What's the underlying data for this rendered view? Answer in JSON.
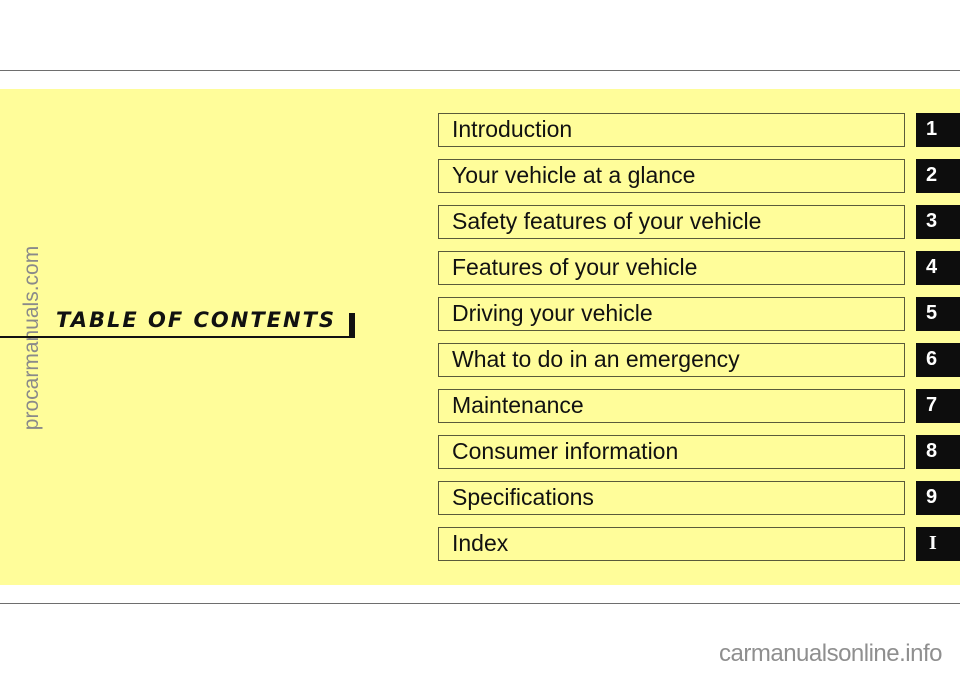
{
  "page": {
    "title": "TABLE OF CONTENTS",
    "background_color": "#fffd9a",
    "tab_color": "#0d0d0d"
  },
  "watermarks": {
    "side": "procarmanuals.com",
    "bottom": "carmanualsonline.info"
  },
  "toc": {
    "items": [
      {
        "label": "Introduction",
        "tab": "1"
      },
      {
        "label": "Your vehicle at a glance",
        "tab": "2"
      },
      {
        "label": "Safety features of your vehicle",
        "tab": "3"
      },
      {
        "label": "Features of your vehicle",
        "tab": "4"
      },
      {
        "label": "Driving your vehicle",
        "tab": "5"
      },
      {
        "label": "What to do in an emergency",
        "tab": "6"
      },
      {
        "label": "Maintenance",
        "tab": "7"
      },
      {
        "label": "Consumer information",
        "tab": "8"
      },
      {
        "label": "Specifications",
        "tab": "9"
      },
      {
        "label": "Index",
        "tab": "I"
      }
    ]
  }
}
